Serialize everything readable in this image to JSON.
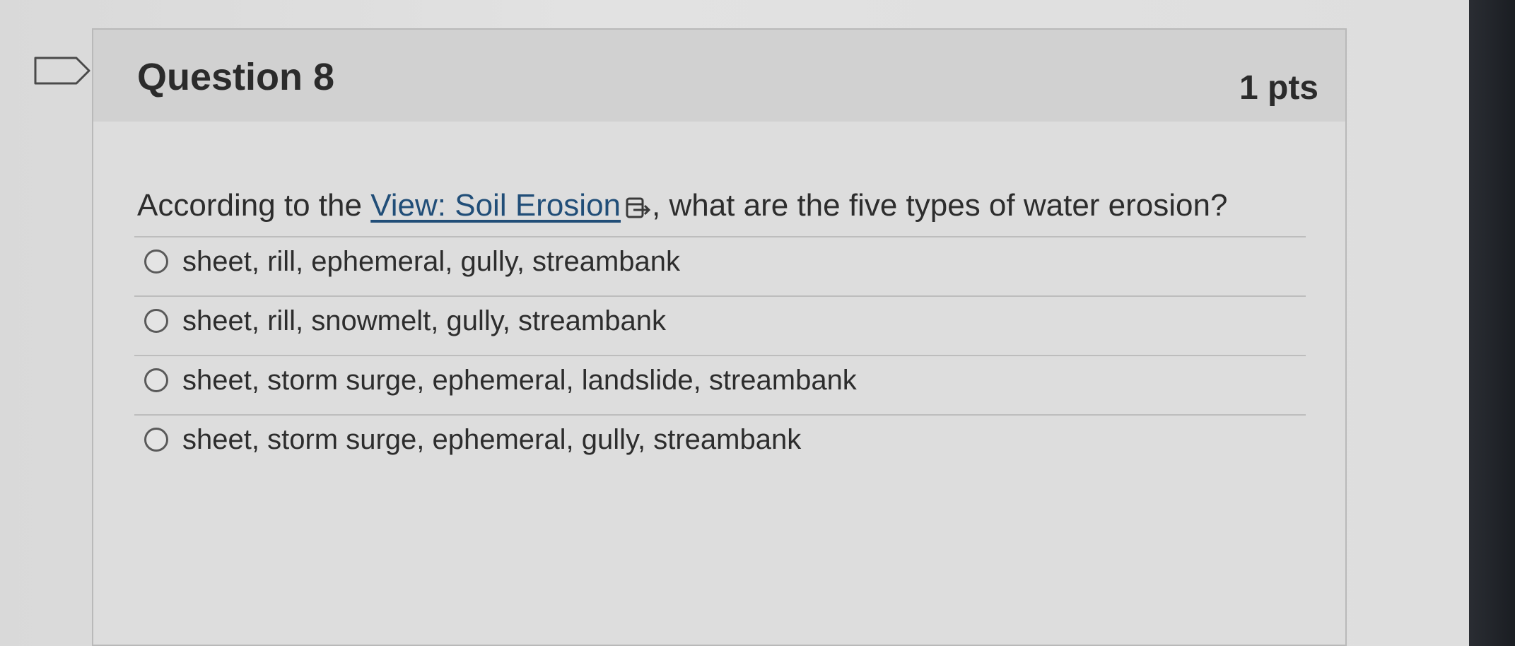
{
  "question": {
    "title": "Question 8",
    "points": "1 pts",
    "text_before": "According to the ",
    "link_text": "View: Soil Erosion",
    "text_after": ", what are the five types of water erosion?",
    "link_icon": "external-link-icon",
    "bookmark_icon": "bookmark-flag-icon"
  },
  "answers": [
    {
      "label": "sheet, rill, ephemeral, gully, streambank"
    },
    {
      "label": "sheet, rill, snowmelt, gully, streambank"
    },
    {
      "label": "sheet, storm surge, ephemeral, landslide, streambank"
    },
    {
      "label": "sheet, storm surge, ephemeral, gully, streambank"
    }
  ],
  "colors": {
    "link": "#214e78",
    "text": "#2d2d2d"
  }
}
